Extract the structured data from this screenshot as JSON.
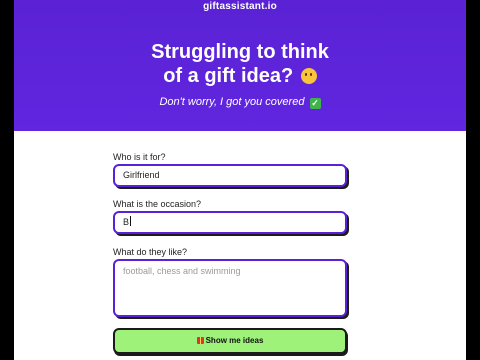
{
  "header": {
    "site_name": "giftassistant.io"
  },
  "hero": {
    "headline_line1": "Struggling to think",
    "headline_line2": "of a gift idea?",
    "headline_emoji": "thinking-face-icon",
    "subline": "Don't worry, I got you covered",
    "subline_emoji": "check-mark-icon"
  },
  "form": {
    "who_label": "Who is it for?",
    "who_value": "Girlfriend",
    "occasion_label": "What is the occasion?",
    "occasion_value": "B",
    "likes_label": "What do they like?",
    "likes_placeholder": "football, chess and swimming",
    "likes_value": "",
    "submit_label": "Show me ideas",
    "submit_icon": "gift-icon"
  },
  "colors": {
    "hero_background": "#5b21d6",
    "input_border": "#5b21d6",
    "button_background": "#9ef27a"
  }
}
